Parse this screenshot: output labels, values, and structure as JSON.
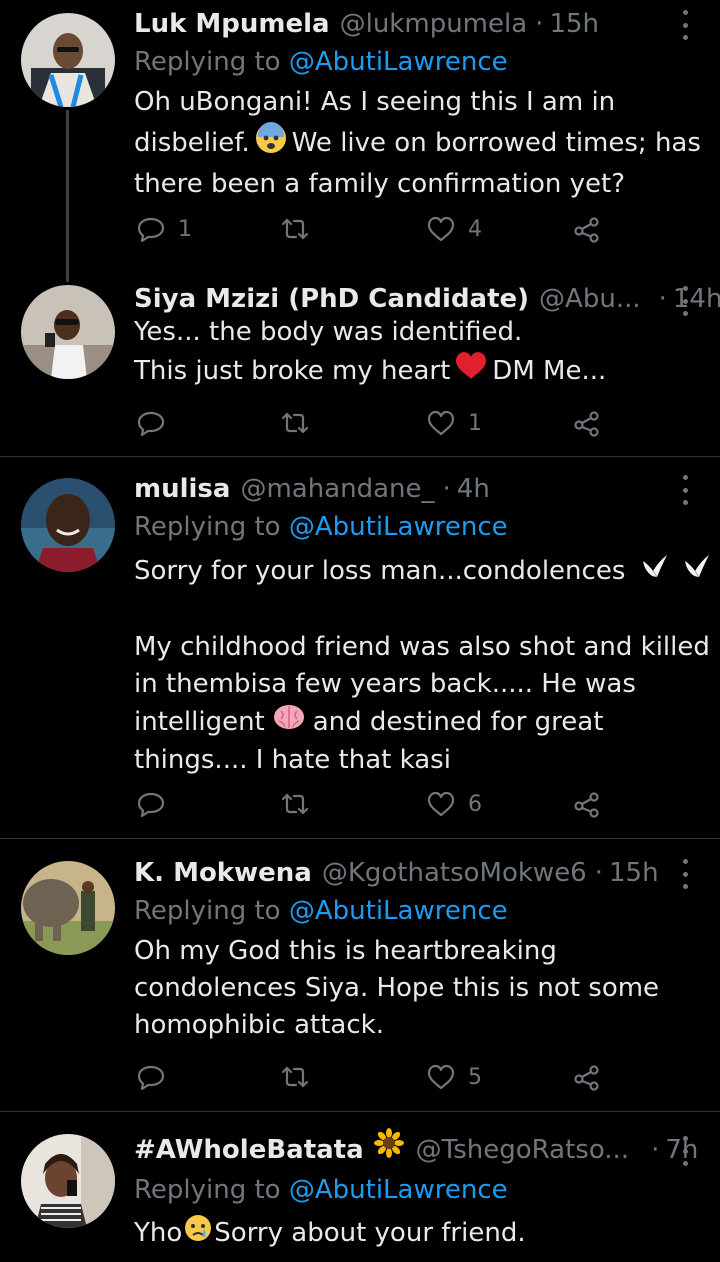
{
  "tweets": [
    {
      "name": "Luk Mpumela",
      "handle": "@lukmpumela",
      "time": "15h",
      "reply_prefix": "Replying to",
      "reply_to": "@AbutiLawrence",
      "lines": [
        "Oh uBongani! As I seeing this I am in",
        "disbelief.",
        "We live on borrowed times; has",
        "there been a family confirmation yet?"
      ],
      "replies": "1",
      "likes": "4"
    },
    {
      "name": "Siya Mzizi (PhD Candidate)",
      "handle": "@Abu...",
      "time": "14h",
      "lines": [
        "Yes... the body was identified.",
        "This just broke my heart",
        "DM Me..."
      ],
      "replies": "",
      "likes": "1"
    },
    {
      "name": "mulisa",
      "handle": "@mahandane_",
      "time": "4h",
      "reply_prefix": "Replying to",
      "reply_to": "@AbutiLawrence",
      "lines": [
        "Sorry for your loss man...condolences",
        "My childhood friend was also shot and killed",
        "in thembisa few years back.....  He was",
        "intelligent",
        "and destined for great",
        "things.... I hate that kasi"
      ],
      "replies": "",
      "likes": "6"
    },
    {
      "name": "K. Mokwena",
      "handle": "@KgothatsoMokwe6",
      "time": "15h",
      "reply_prefix": "Replying to",
      "reply_to": "@AbutiLawrence",
      "lines": [
        "Oh my God this is heartbreaking",
        "condolences Siya. Hope this is not some",
        "homophibic attack."
      ],
      "replies": "",
      "likes": "5"
    },
    {
      "name": "#AWholeBatata",
      "handle": "@TshegoRatso...",
      "time": "7h",
      "reply_prefix": "Replying to",
      "reply_to": "@AbutiLawrence",
      "lines": [
        "Yho",
        "Sorry about your friend."
      ]
    }
  ],
  "separator": "·",
  "icons": {
    "reply": "reply-icon",
    "retweet": "retweet-icon",
    "like": "like-icon",
    "share": "share-icon",
    "more": "more-icon"
  },
  "colors": {
    "background": "#000000",
    "text": "#e7e9ea",
    "muted": "#71767b",
    "link": "#1d9bf0",
    "divider": "#2f3336"
  }
}
